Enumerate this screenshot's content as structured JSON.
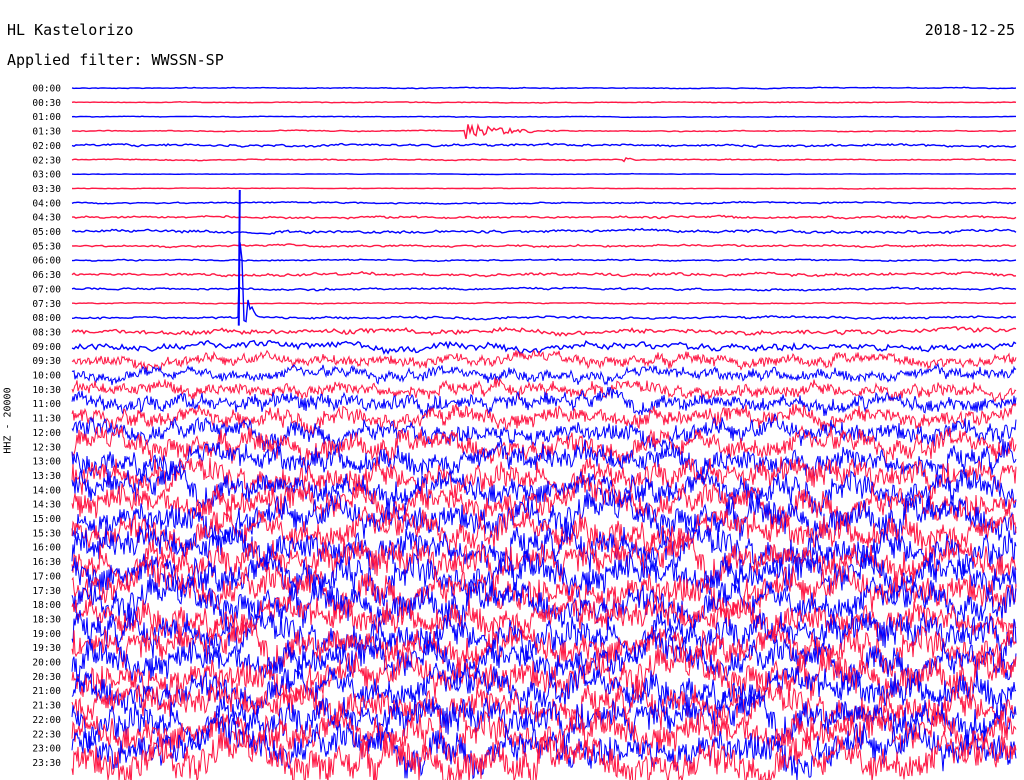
{
  "header": {
    "station": "HL Kastelorizo",
    "filter": "Applied filter: WWSSN-SP",
    "date": "2018-12-25"
  },
  "chart_data": {
    "type": "line",
    "title": "HL Kastelorizo",
    "subtitle": "Applied filter: WWSSN-SP",
    "date": "2018-12-25",
    "ylabel": "HHZ - 20000",
    "xlabel": "",
    "row_labels": [
      "00:00",
      "00:30",
      "01:00",
      "01:30",
      "02:00",
      "02:30",
      "03:00",
      "03:30",
      "04:00",
      "04:30",
      "05:00",
      "05:30",
      "06:00",
      "06:30",
      "07:00",
      "07:30",
      "08:00",
      "08:30",
      "09:00",
      "09:30",
      "10:00",
      "10:30",
      "11:00",
      "11:30",
      "12:00",
      "12:30",
      "13:00",
      "13:30",
      "14:00",
      "14:30",
      "15:00",
      "15:30",
      "16:00",
      "16:30",
      "17:00",
      "17:30",
      "18:00",
      "18:30",
      "19:00",
      "19:30",
      "20:00",
      "20:30",
      "21:00",
      "21:30",
      "22:00",
      "22:30",
      "23:00",
      "23:30"
    ],
    "colors": {
      "blue": "#0000ff",
      "red": "#ff1744",
      "axis": "#000000"
    },
    "noise_level": [
      0.6,
      0.5,
      0.5,
      0.7,
      1.6,
      0.8,
      0.3,
      0.4,
      1.0,
      1.6,
      2.0,
      1.4,
      1.0,
      2.0,
      1.4,
      0.7,
      1.6,
      3.5,
      5.5,
      7.5,
      8,
      9,
      11,
      12,
      14,
      16,
      17,
      18,
      19,
      20,
      21,
      21,
      22,
      22,
      23,
      23,
      22,
      21,
      22,
      22,
      22,
      23,
      22,
      22,
      23,
      23,
      24,
      25
    ],
    "events": [
      {
        "row": "01:30",
        "minute": 12.5,
        "amplitude": 9,
        "duration_min": 3
      },
      {
        "row": "02:30",
        "minute": 17.5,
        "amplitude": 2.5,
        "duration_min": 0.8
      },
      {
        "row": "08:00",
        "minute": 5.3,
        "amplitude": 120,
        "duration_min": 0.6
      }
    ],
    "grid": false
  }
}
